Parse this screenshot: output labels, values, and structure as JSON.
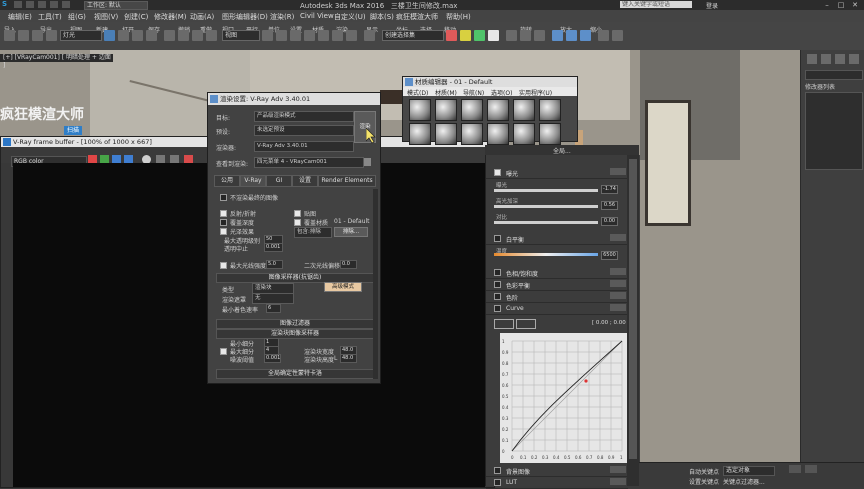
{
  "app": {
    "title": "Autodesk 3ds Max 2016",
    "file": "三楼卫生间修改.max",
    "workspace": "工作区: 默认",
    "search_placeholder": "键入关键字或短语",
    "login": "登录"
  },
  "menus": [
    "编辑(E)",
    "工具(T)",
    "组(G)",
    "视图(V)",
    "创建(C)",
    "修改器(M)",
    "动画(A)",
    "图形编辑器(D)",
    "渲染(R)",
    "Civil View",
    "自定义(U)",
    "脚本(S)",
    "疯狂模渲大师",
    "帮助(H)"
  ],
  "toolbar": {
    "labels": [
      "导入",
      "导出",
      "视图",
      "新建",
      "打开",
      "保存",
      "撤销",
      "重做",
      "视口",
      "平行",
      "单位",
      "设置",
      "材质",
      "渲染",
      "显示",
      "坐标",
      "选择",
      "移动",
      "旋转",
      "放大",
      "缩小",
      "刷新",
      "渲染",
      "隐藏",
      "冻结",
      "边面",
      "对齐",
      "分离",
      "线框",
      "显示",
      "锁定",
      "解冻",
      "设置",
      "设置",
      "帮助",
      "控制"
    ],
    "selection_filter": "灯光",
    "view_dropdown": "视图",
    "named_selection": "创建选择集"
  },
  "viewport": {
    "label": "[+] [VRayCam001] [ 明暗处理 + 边面 ]",
    "watermark_title": "疯狂模渲大师",
    "watermark_button": "扫描"
  },
  "command_panel": {
    "modifier_list": "修改器列表"
  },
  "frame_buffer": {
    "title": "V-Ray frame buffer - [100% of 1000 x 667]",
    "channel": "RGB color"
  },
  "render_setup": {
    "title": "渲染设置: V-Ray Adv 3.40.01",
    "target_label": "目标:",
    "target_value": "产品级渲染模式",
    "preset_label": "预设:",
    "preset_value": "未选定预设",
    "renderer_label": "渲染器:",
    "renderer_value": "V-Ray Adv 3.40.01",
    "view_label": "查看到渲染:",
    "view_value": "四元菜单 4 - VRayCam001",
    "render_button": "渲染",
    "tabs": [
      "公用",
      "V-Ray",
      "GI",
      "设置",
      "Render Elements"
    ],
    "disable_renderer_window": "不渲染最终的图像",
    "glossy_effects": "反射/折射",
    "override_depth": "覆盖深度",
    "gloss_effects": "光泽效果",
    "max_transp_levels": "最大透明级别",
    "max_transp_value": "50",
    "transp_cutoff": "透明中止",
    "transp_cutoff_value": "0.001",
    "maps": "贴图",
    "override_mtl": "覆盖材质",
    "override_mtl_value": "01 - Default",
    "include_exclude": "排除...",
    "filter_mode": "包含:排除",
    "max_ray_intensity": "最大光线强度",
    "max_ray_value": "5.0",
    "secondary_bias": "二次光线偏移",
    "secondary_bias_value": "0.0",
    "image_sampler_section": "图像采样器(抗锯齿)",
    "type_label": "类型",
    "type_value": "渲染块",
    "render_mask_label": "渲染遮罩",
    "render_mask_value": "无",
    "min_shading_label": "最小着色速率",
    "min_shading_value": "6",
    "advanced_mode": "高级模式",
    "image_filter_section": "图像过滤器",
    "bucket_section": "渲染块图像采样器",
    "min_subdivs": "最小细分",
    "min_subdivs_value": "1",
    "max_subdivs": "最大细分",
    "max_subdivs_value": "4",
    "noise_threshold": "噪波阈值",
    "noise_threshold_value": "0.001",
    "bucket_width": "渲染块宽度",
    "bucket_width_value": "48.0",
    "bucket_height": "渲染块高度",
    "bucket_height_value": "48.0",
    "bucket_l": "L",
    "global_dmc_section": "全局确定性蒙特卡洛"
  },
  "material_editor": {
    "title": "材质编辑器 - 01 - Default",
    "menus": [
      "模式(D)",
      "材质(M)",
      "导航(N)",
      "选项(O)",
      "实用程序(U)"
    ]
  },
  "corrections": {
    "header": "全局...",
    "exposure": "曝光",
    "exposure_sub1": "曝光",
    "exposure_sub1_value": "-1.74",
    "exposure_sub2": "高光加深",
    "exposure_sub2_value": "0.56",
    "exposure_sub3": "对比",
    "exposure_sub3_value": "0.00",
    "white_balance": "白平衡",
    "white_balance_sub": "温度",
    "white_balance_value": "6500",
    "hue_sat": "色相/饱和度",
    "color_balance": "色彩平衡",
    "levels": "色阶",
    "curve": "Curve",
    "curve_coords": "[ 0.00 ; 0.00 ]",
    "bg_image": "背景图像",
    "lut": "LUT",
    "curve_ticks": [
      "1",
      "0.9",
      "0.8",
      "0.7",
      "0.6",
      "0.5",
      "0.4",
      "0.3",
      "0.2",
      "0.1",
      "0"
    ],
    "curve_xticks": [
      "0",
      "0.1",
      "0.2",
      "0.3",
      "0.4",
      "0.5",
      "0.6",
      "0.7",
      "0.8",
      "0.9",
      "1"
    ]
  },
  "timeline": {
    "auto_key": "自动关键点",
    "selection": "选定对象",
    "set_key": "设置关键点",
    "key_filters": "关键点过滤器..."
  }
}
